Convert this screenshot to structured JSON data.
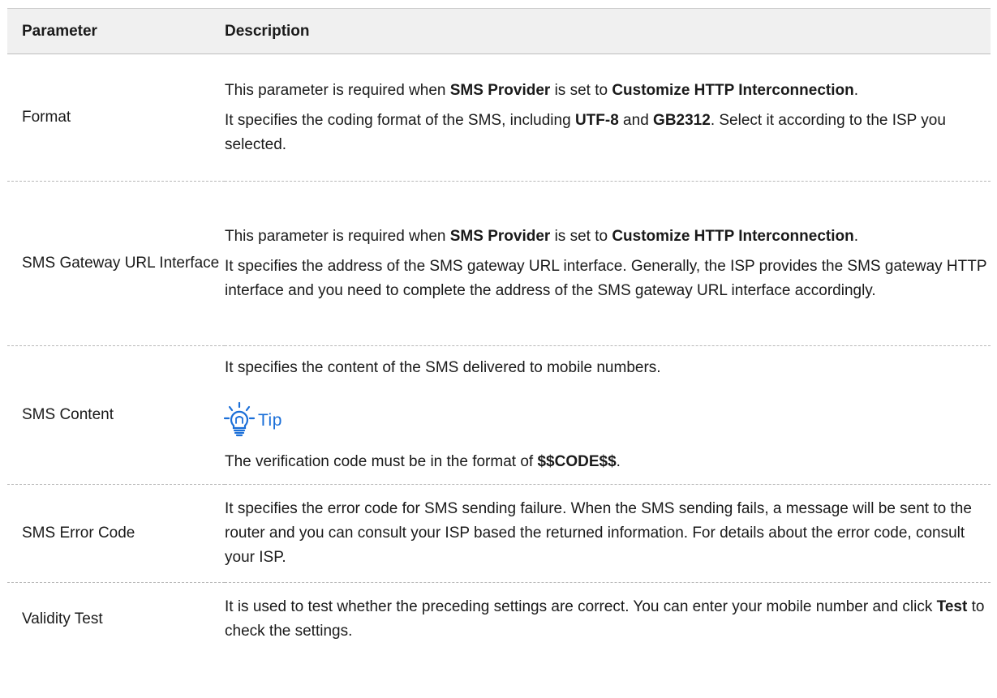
{
  "table": {
    "headers": {
      "parameter": "Parameter",
      "description": "Description"
    },
    "rows": [
      {
        "parameter": "Format",
        "p1": {
          "a": "This parameter is required when ",
          "b1": "SMS Provider",
          "c": " is set to ",
          "b2": "Customize HTTP Interconnection",
          "d": "."
        },
        "p2": {
          "a": "It specifies the coding format of the SMS, including ",
          "b1": "UTF-8",
          "c": " and ",
          "b2": "GB2312",
          "d": ". Select it according to the ISP you selected."
        }
      },
      {
        "parameter": "SMS Gateway URL Interface",
        "p1": {
          "a": "This parameter is required when ",
          "b1": "SMS Provider",
          "c": " is set to ",
          "b2": "Customize HTTP Interconnection",
          "d": "."
        },
        "p2": "It specifies the address of the SMS gateway URL interface. Generally, the ISP provides the SMS gateway HTTP interface and you need to complete the address of the SMS gateway URL interface accordingly."
      },
      {
        "parameter": "SMS Content",
        "p1": "It specifies the content of the SMS delivered to mobile numbers.",
        "tip_icon": "lightbulb-icon",
        "tip_label": "Tip",
        "tip_color": "#1b6fd8",
        "p2": {
          "a": "The verification code must be in the format of ",
          "b": "$$CODE$$",
          "c": "."
        }
      },
      {
        "parameter": "SMS Error Code",
        "p1": "It specifies the error code for SMS sending failure. When the SMS sending fails, a message will be sent to the router and you can consult your ISP based the returned information. For details about the error code, consult your ISP."
      },
      {
        "parameter": "Validity Test",
        "p1": {
          "a": "It is used to test whether the preceding settings are correct. You can enter your mobile number and click ",
          "b": "Test",
          "c": " to check the settings."
        }
      }
    ]
  }
}
